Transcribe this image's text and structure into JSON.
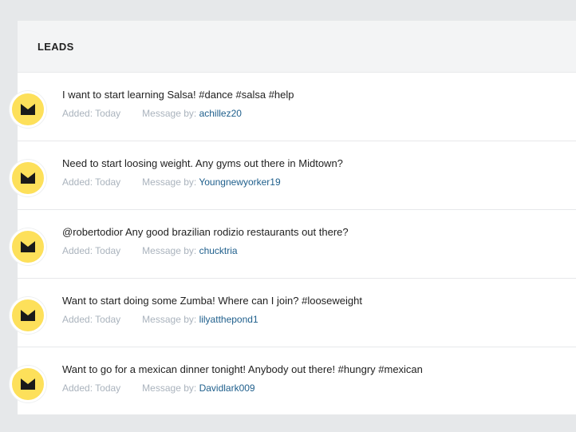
{
  "panel": {
    "title": "LEADS"
  },
  "leads": [
    {
      "message": "I want to start learning Salsa! #dance #salsa #help",
      "added": "Added: Today",
      "message_by_label": "Message by:",
      "username": "achillez20"
    },
    {
      "message": "Need to start loosing weight. Any gyms out there in Midtown?",
      "added": "Added: Today",
      "message_by_label": "Message by:",
      "username": "Youngnewyorker19"
    },
    {
      "message": "@robertodior Any good brazilian rodizio restaurants out there?",
      "added": "Added: Today",
      "message_by_label": "Message by:",
      "username": "chucktria"
    },
    {
      "message": "Want to start doing some Zumba! Where can I join? #looseweight",
      "added": "Added: Today",
      "message_by_label": "Message by:",
      "username": "lilyatthepond1"
    },
    {
      "message": "Want to go for a mexican dinner tonight! Anybody out there! #hungry #mexican",
      "added": "Added: Today",
      "message_by_label": "Message by:",
      "username": "Davidlark009"
    }
  ],
  "colors": {
    "avatar_bg": "#fde05a",
    "username": "#1f5f8c",
    "meta": "#aab3bd",
    "page_bg": "#e6e8ea"
  },
  "icons": {
    "avatar": "crown-icon"
  }
}
